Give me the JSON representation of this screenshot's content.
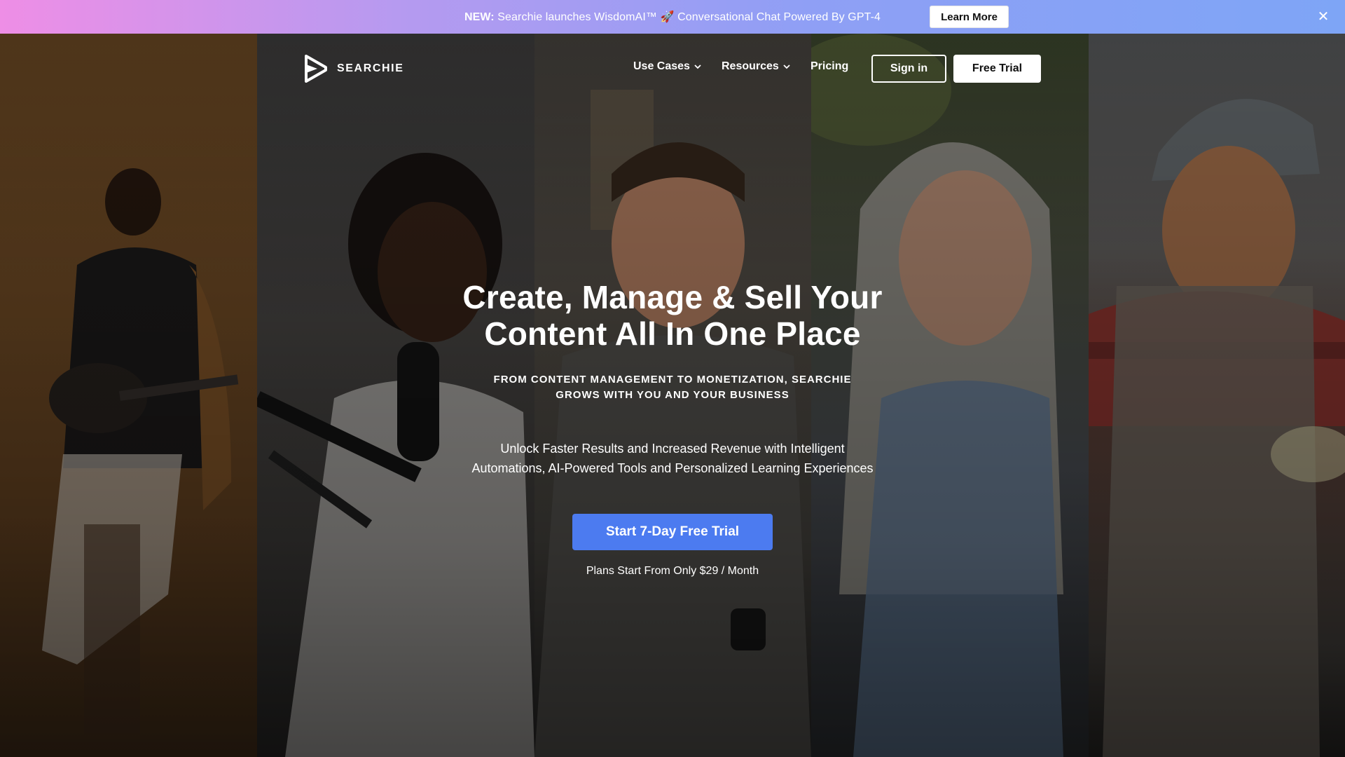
{
  "announcement": {
    "new_label": "NEW:",
    "message": "Searchie launches WisdomAI™ 🚀 Conversational Chat Powered By GPT-4",
    "learn_more": "Learn More",
    "close_icon": "close-icon"
  },
  "nav": {
    "logo_text": "SEARCHIE",
    "links": [
      {
        "label": "Use Cases",
        "has_dropdown": true
      },
      {
        "label": "Resources",
        "has_dropdown": true
      },
      {
        "label": "Pricing",
        "has_dropdown": false
      }
    ],
    "sign_in": "Sign in",
    "free_trial": "Free Trial"
  },
  "hero": {
    "headline_line1": "Create, Manage & Sell Your",
    "headline_line2": "Content All In One Place",
    "subheading_line1": "FROM CONTENT MANAGEMENT TO MONETIZATION, SEARCHIE",
    "subheading_line2": "GROWS WITH YOU AND YOUR BUSINESS",
    "description_line1": "Unlock Faster Results and Increased Revenue with Intelligent",
    "description_line2": "Automations, AI-Powered Tools and Personalized Learning Experiences",
    "cta": "Start 7-Day Free Trial",
    "plans_note": "Plans Start From Only $29 / Month"
  },
  "colors": {
    "announce_gradient_start": "#ee8ee6",
    "announce_gradient_end": "#7ea5f6",
    "cta_blue": "#4c7bf0"
  }
}
